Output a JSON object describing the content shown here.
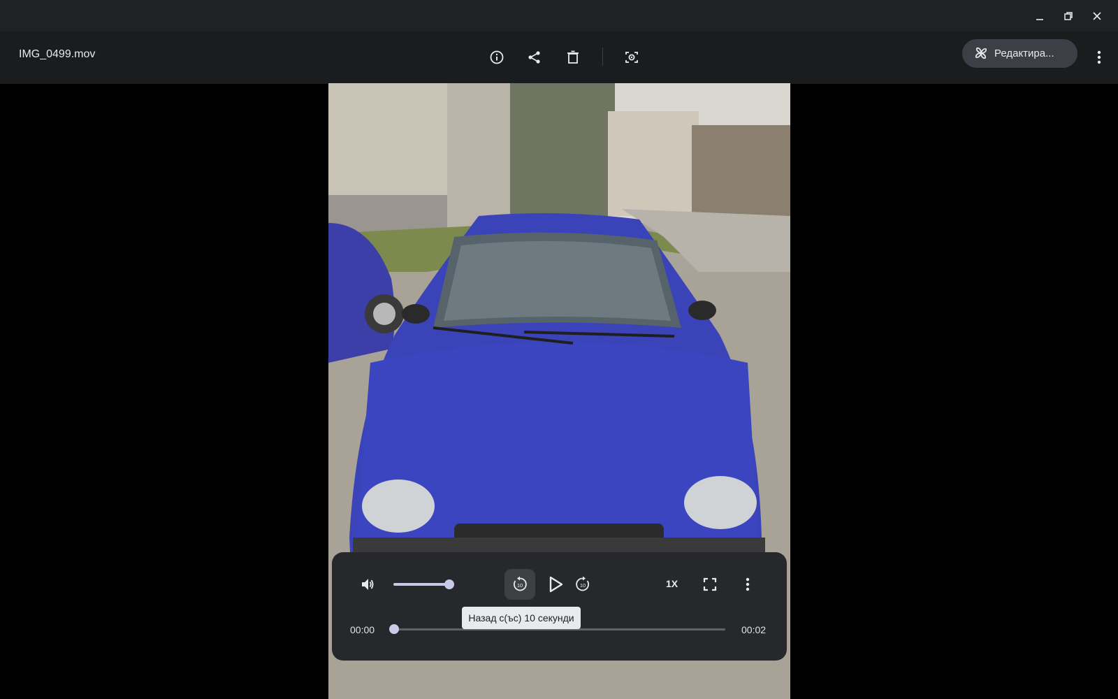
{
  "window": {
    "controls": [
      "minimize-icon",
      "restore-icon",
      "close-icon"
    ]
  },
  "toolbar": {
    "filename": "IMG_0499.mov",
    "icons": [
      "info-icon",
      "share-icon",
      "delete-icon",
      "lens-icon"
    ],
    "edit_label": "Редактира...",
    "more_icon": "more-vert-icon"
  },
  "player": {
    "current_time": "00:00",
    "duration": "00:02",
    "speed": "1X",
    "volume_fraction": 1.0,
    "progress_fraction": 0.0,
    "rewind_seconds": "10",
    "forward_seconds": "10",
    "tooltip": "Назад с(ъс) 10 секунди"
  },
  "colors": {
    "titlebar": "#202124",
    "toolbar": "#1b1c1e",
    "accent": "#c8cbe8",
    "edit_button": "#3c3f45"
  }
}
